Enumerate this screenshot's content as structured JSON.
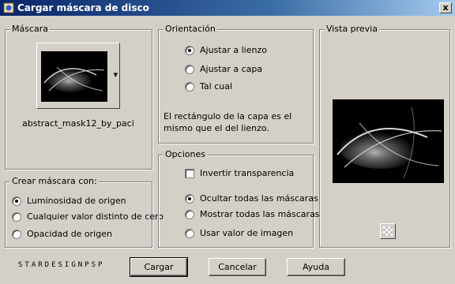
{
  "window": {
    "title": "Cargar máscara de disco",
    "close_glyph": "x",
    "icon": "psp-mask-icon"
  },
  "mascara": {
    "legend": "Máscara",
    "filename": "abstract_mask12_by_paci"
  },
  "crear": {
    "legend": "Crear máscara con:",
    "options": [
      "Luminosidad de origen",
      "Cualquier valor distinto de cero",
      "Opacidad de origen"
    ],
    "selected": 0
  },
  "orientacion": {
    "legend": "Orientación",
    "options": [
      "Ajustar a lienzo",
      "Ajustar a capa",
      "Tal cual"
    ],
    "selected": 0,
    "description": "El rectángulo de la capa es el mismo que el del lienzo."
  },
  "opciones": {
    "legend": "Opciones",
    "invert_label": "Invertir transparencia",
    "invert_checked": false,
    "options": [
      "Ocultar todas las máscaras",
      "Mostrar todas las máscaras",
      "Usar valor de imagen"
    ],
    "selected": 0
  },
  "vista": {
    "legend": "Vista previa"
  },
  "buttons": {
    "load": "Cargar",
    "cancel": "Cancelar",
    "help": "Ayuda"
  },
  "brand": "STARDESIGNPSP"
}
